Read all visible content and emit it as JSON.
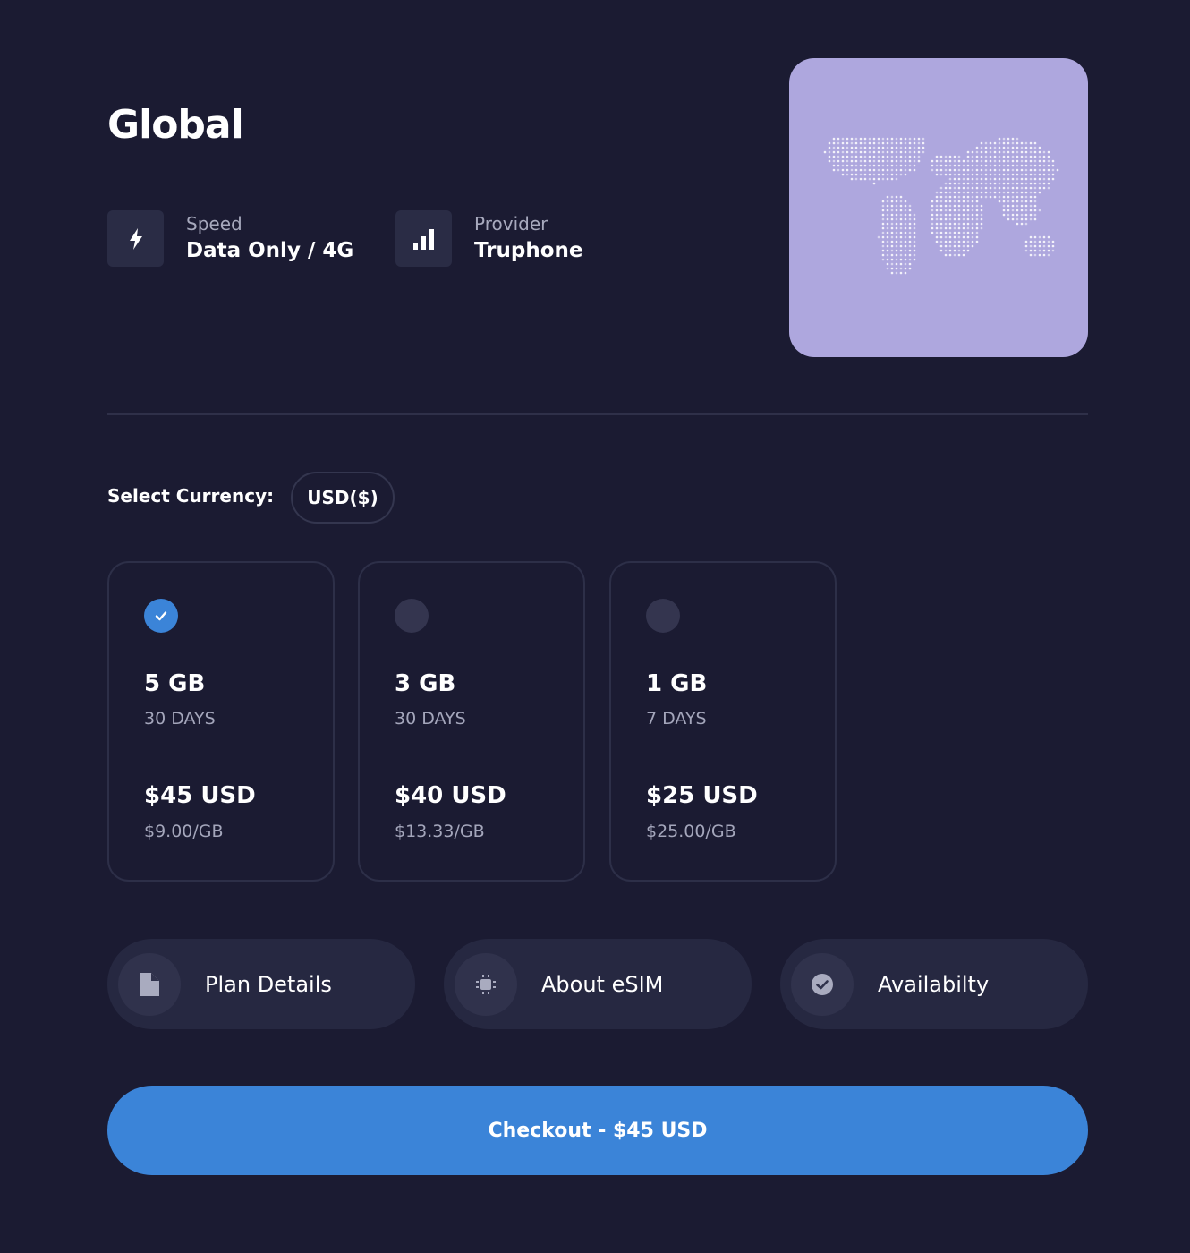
{
  "title": "Global",
  "specs": {
    "speed": {
      "label": "Speed",
      "value": "Data Only / 4G",
      "icon": "lightning-icon"
    },
    "provider": {
      "label": "Provider",
      "value": "Truphone",
      "icon": "signal-bars-icon"
    }
  },
  "map": {
    "icon": "world-map-icon",
    "background": "#aea7de"
  },
  "currency": {
    "label": "Select Currency:",
    "selected": "USD($)"
  },
  "plans": [
    {
      "data": "5 GB",
      "duration": "30 DAYS",
      "price": "$45 USD",
      "rate": "$9.00/GB",
      "selected": true
    },
    {
      "data": "3 GB",
      "duration": "30 DAYS",
      "price": "$40 USD",
      "rate": "$13.33/GB",
      "selected": false
    },
    {
      "data": "1 GB",
      "duration": "7 DAYS",
      "price": "$25 USD",
      "rate": "$25.00/GB",
      "selected": false
    }
  ],
  "info_buttons": [
    {
      "label": "Plan Details",
      "icon": "document-icon"
    },
    {
      "label": "About eSIM",
      "icon": "chip-icon"
    },
    {
      "label": "Availabilty",
      "icon": "check-circle-icon"
    }
  ],
  "checkout": {
    "label": "Checkout - $45 USD"
  },
  "colors": {
    "background": "#1b1b32",
    "accent": "#3b84d8",
    "card_border": "#2d2f48",
    "muted_text": "#a4a6bb"
  }
}
